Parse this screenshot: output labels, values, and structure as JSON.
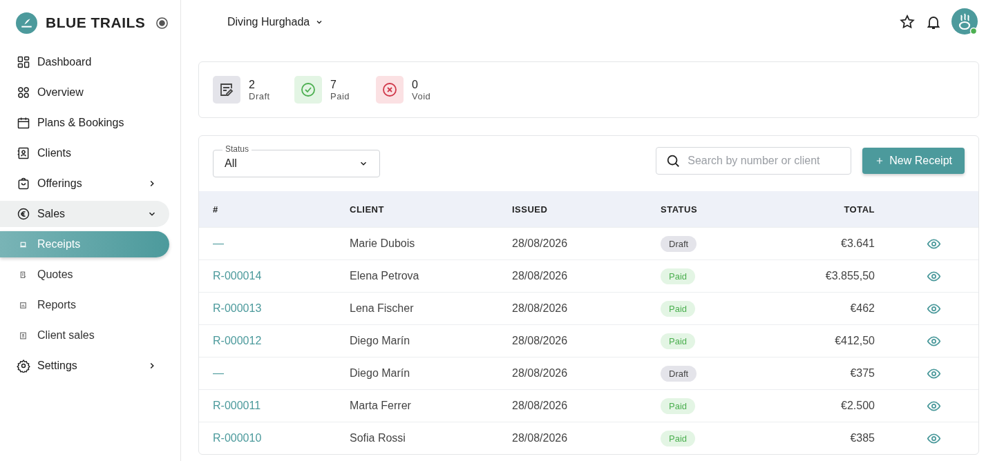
{
  "brand": {
    "name": "BLUE TRAILS"
  },
  "sidebar": {
    "items": [
      {
        "label": "Dashboard",
        "selected": false
      },
      {
        "label": "Overview",
        "selected": false
      },
      {
        "label": "Plans & Bookings",
        "selected": false
      },
      {
        "label": "Clients",
        "selected": false
      },
      {
        "label": "Offerings",
        "selected": false,
        "expanded": false
      },
      {
        "label": "Sales",
        "selected": false,
        "expanded": true,
        "children": [
          {
            "label": "Receipts",
            "selected": true
          },
          {
            "label": "Quotes",
            "selected": false
          },
          {
            "label": "Reports",
            "selected": false
          },
          {
            "label": "Client sales",
            "selected": false
          }
        ]
      },
      {
        "label": "Settings",
        "selected": false,
        "expanded": false
      }
    ]
  },
  "topbar": {
    "workspace": "Diving Hurghada"
  },
  "stats": [
    {
      "kind": "draft",
      "count": "2",
      "label": "Draft"
    },
    {
      "kind": "paid",
      "count": "7",
      "label": "Paid"
    },
    {
      "kind": "void",
      "count": "0",
      "label": "Void"
    }
  ],
  "filter": {
    "label": "Status",
    "value": "All"
  },
  "search": {
    "placeholder": "Search by number or client"
  },
  "new_button": {
    "label": "New Receipt"
  },
  "table": {
    "columns": [
      "#",
      "CLIENT",
      "ISSUED",
      "STATUS",
      "TOTAL"
    ],
    "rows": [
      {
        "number": "—",
        "client": "Marie Dubois",
        "issued": "28/08/2026",
        "status": {
          "kind": "draft",
          "label": "Draft"
        },
        "total": "€3.641"
      },
      {
        "number": "R-000014",
        "client": "Elena Petrova",
        "issued": "28/08/2026",
        "status": {
          "kind": "paid",
          "label": "Paid"
        },
        "total": "€3.855,50"
      },
      {
        "number": "R-000013",
        "client": "Lena Fischer",
        "issued": "28/08/2026",
        "status": {
          "kind": "paid",
          "label": "Paid"
        },
        "total": "€462"
      },
      {
        "number": "R-000012",
        "client": "Diego Marín",
        "issued": "28/08/2026",
        "status": {
          "kind": "paid",
          "label": "Paid"
        },
        "total": "€412,50"
      },
      {
        "number": "—",
        "client": "Diego Marín",
        "issued": "28/08/2026",
        "status": {
          "kind": "draft",
          "label": "Draft"
        },
        "total": "€375"
      },
      {
        "number": "R-000011",
        "client": "Marta Ferrer",
        "issued": "28/08/2026",
        "status": {
          "kind": "paid",
          "label": "Paid"
        },
        "total": "€2.500"
      },
      {
        "number": "R-000010",
        "client": "Sofia Rossi",
        "issued": "28/08/2026",
        "status": {
          "kind": "paid",
          "label": "Paid"
        },
        "total": "€385"
      }
    ]
  }
}
